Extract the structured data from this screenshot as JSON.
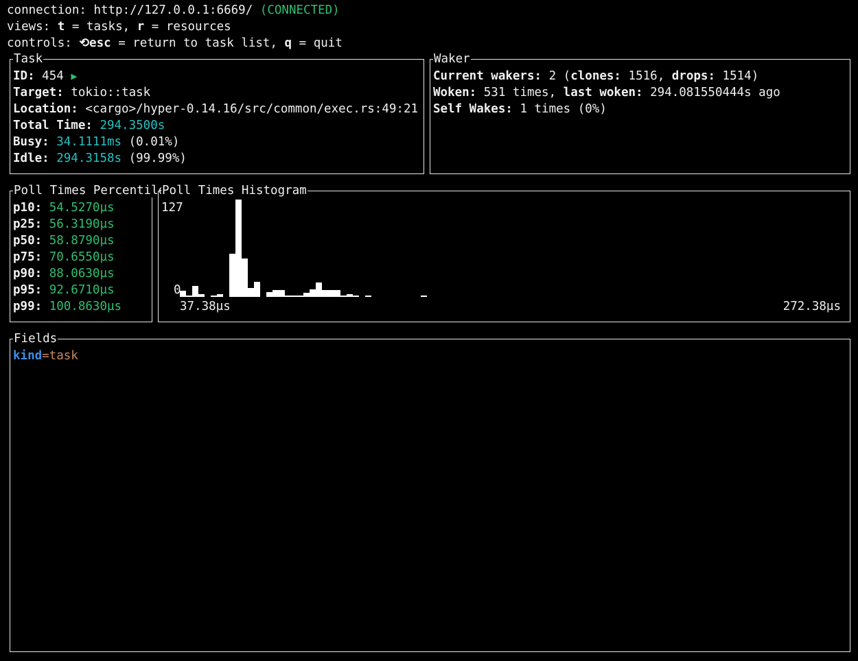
{
  "header": {
    "connection_label": "connection:",
    "connection_url": "http://127.0.0.1:6669/",
    "connection_status": "(CONNECTED)",
    "views_label": "views:",
    "views_t_key": "t",
    "views_t_desc": "= tasks,",
    "views_r_key": "r",
    "views_r_desc": "= resources",
    "controls_label": "controls:",
    "controls_esc_icon": "⟲",
    "controls_esc_key": "esc",
    "controls_esc_desc": "= return to task list,",
    "controls_q_key": "q",
    "controls_q_desc": "= quit"
  },
  "task": {
    "title": "Task",
    "id_label": "ID:",
    "id_value": "454",
    "id_icon": "play-icon",
    "target_label": "Target:",
    "target_value": "tokio::task",
    "location_label": "Location:",
    "location_value": "<cargo>/hyper-0.14.16/src/common/exec.rs:49:21",
    "total_label": "Total Time:",
    "total_value": "294.3500s",
    "busy_label": "Busy:",
    "busy_value": "34.1111ms",
    "busy_pct": "(0.01%)",
    "idle_label": "Idle:",
    "idle_value": "294.3158s",
    "idle_pct": "(99.99%)"
  },
  "waker": {
    "title": "Waker",
    "current_label": "Current wakers:",
    "current_value": "2",
    "clones_label": "clones:",
    "clones_value": "1516",
    "drops_label": "drops:",
    "drops_value": "1514",
    "woken_label": "Woken:",
    "woken_value": "531 times,",
    "last_label": "last woken:",
    "last_value": "294.081550444s ago",
    "self_label": "Self Wakes:",
    "self_value": "1 times (0%)"
  },
  "percentiles": {
    "title": "Poll Times Percentiles",
    "rows": [
      {
        "label": "p10:",
        "value": "54.5270µs"
      },
      {
        "label": "p25:",
        "value": "56.3190µs"
      },
      {
        "label": "p50:",
        "value": "58.8790µs"
      },
      {
        "label": "p75:",
        "value": "70.6550µs"
      },
      {
        "label": "p90:",
        "value": "88.0630µs"
      },
      {
        "label": "p95:",
        "value": "92.6710µs"
      },
      {
        "label": "p99:",
        "value": "100.8630µs"
      }
    ]
  },
  "histogram": {
    "title": "Poll Times Histogram",
    "max_label": "127",
    "min_label": "0",
    "x_min_label": "37.38µs",
    "x_max_label": "272.38µs"
  },
  "chart_data": {
    "type": "bar",
    "title": "Poll Times Histogram",
    "ylim": [
      0,
      127
    ],
    "xlim_labels": [
      "37.38µs",
      "272.38µs"
    ],
    "values": [
      8,
      2,
      14,
      4,
      0,
      2,
      4,
      0,
      56,
      127,
      50,
      12,
      20,
      0,
      6,
      9,
      9,
      2,
      2,
      2,
      5,
      10,
      19,
      9,
      9,
      9,
      2,
      4,
      2,
      0,
      2,
      0,
      0,
      0,
      0,
      0,
      0,
      0,
      0,
      2
    ]
  },
  "fields": {
    "title": "Fields",
    "key": "kind",
    "eq": "=",
    "value": "task"
  }
}
